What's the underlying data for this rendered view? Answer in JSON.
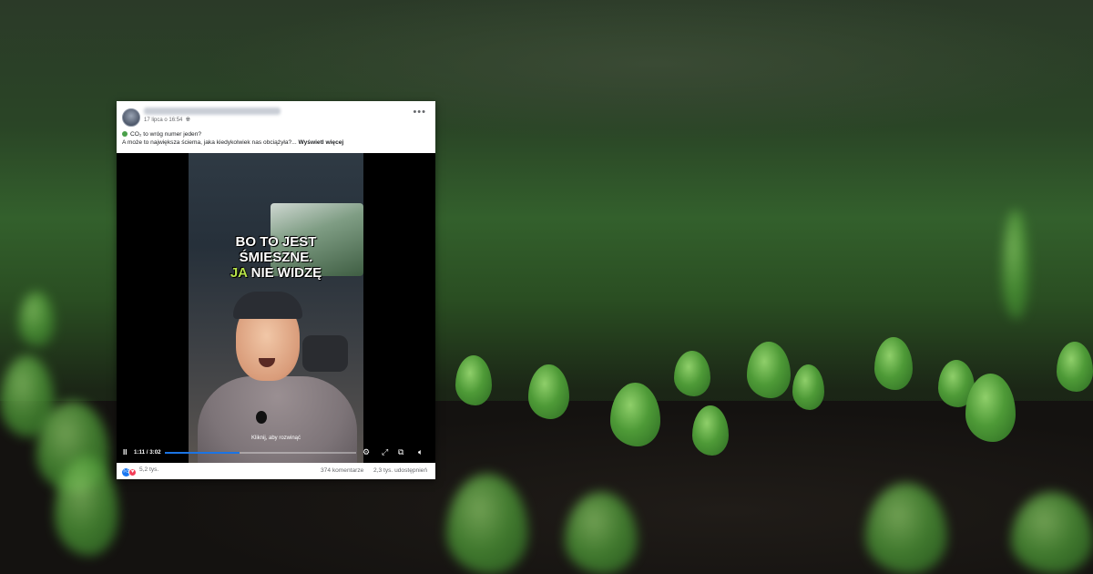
{
  "post": {
    "time": "17 lipca o 16:54",
    "privacy_icon": "globe-icon",
    "more_icon": "more-horizontal-icon",
    "more_label": "•••",
    "line1": "CO₂ to wróg numer jeden?",
    "line2": "A może to największa ściema, jaka kiedykolwiek nas obciążyła?...",
    "see_more": "Wyświetl więcej"
  },
  "video": {
    "caption_line1": "BO TO JEST",
    "caption_line2": "ŚMIESZNE.",
    "caption_line3_highlight": "JA",
    "caption_line3_rest": " NIE WIDZĘ",
    "unmute_hint": "Kliknij, aby rozwinąć",
    "play_icon": "pause-icon",
    "play_label": "II",
    "time": "1:11 / 3:02",
    "progress": 0.39,
    "settings_icon": "gear-icon",
    "fullscreen_icon": "fullscreen-icon",
    "pip_icon": "picture-in-picture-icon",
    "volume_icon": "volume-icon"
  },
  "footer": {
    "reactions": "5,2 tys.",
    "comments": "374 komentarze",
    "shares": "2,3 tys. udostępnień"
  },
  "colors": {
    "accent": "#1b74e4",
    "caption_highlight": "#b7e24a",
    "like": "#1877f2",
    "love": "#f33e58"
  }
}
